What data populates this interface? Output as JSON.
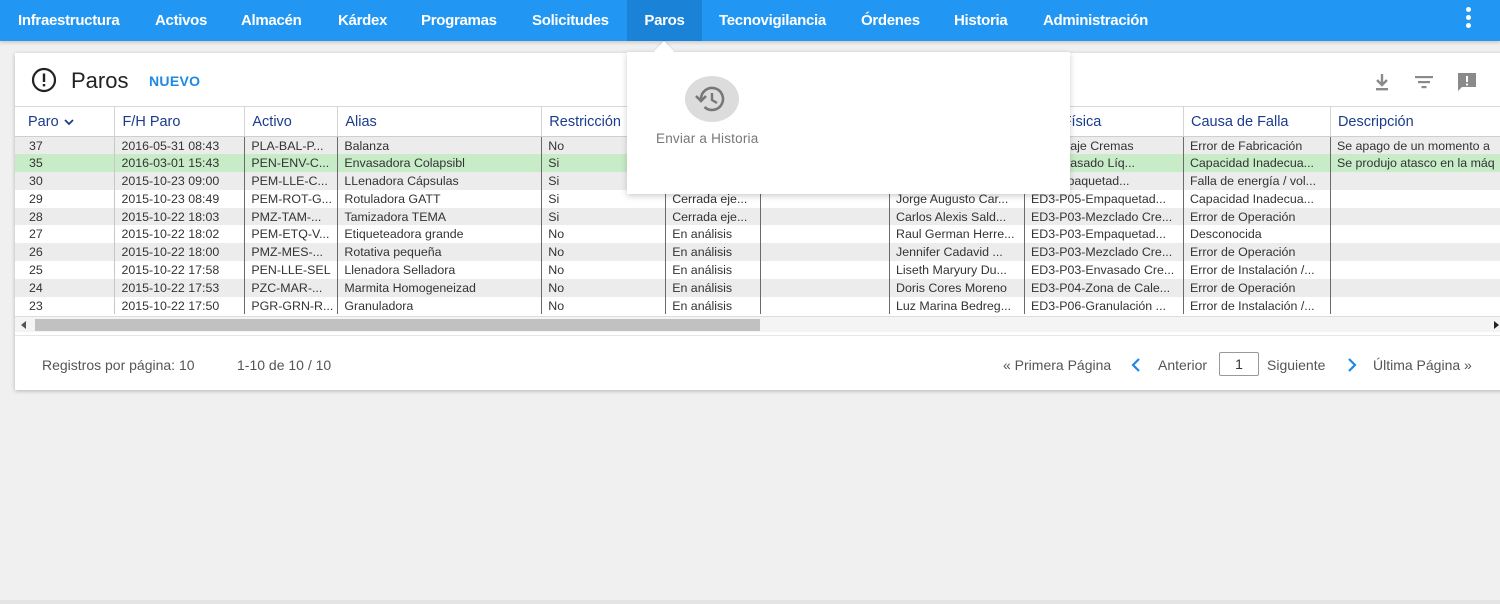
{
  "nav": {
    "items": [
      {
        "label": "Infraestructura"
      },
      {
        "label": "Activos"
      },
      {
        "label": "Almacén"
      },
      {
        "label": "Kárdex"
      },
      {
        "label": "Programas"
      },
      {
        "label": "Solicitudes"
      },
      {
        "label": "Paros"
      },
      {
        "label": "Tecnovigilancia"
      },
      {
        "label": "Órdenes"
      },
      {
        "label": "Historia"
      },
      {
        "label": "Administración"
      }
    ],
    "active": "Paros",
    "more_icon": "more-vert-icon"
  },
  "card": {
    "title": "Paros",
    "new_label": "NUEVO",
    "title_icon": "alert-circle-icon",
    "actions": [
      "download-icon",
      "filter-icon",
      "feedback-icon"
    ]
  },
  "table": {
    "columns": [
      "Paro",
      "F/H Paro",
      "Activo",
      "Alias",
      "Restricción",
      "",
      "",
      "",
      "ción Física",
      "Causa de Falla",
      "Descripción"
    ],
    "sort_column": "Paro",
    "rows": [
      [
        "37",
        "2016-05-31 08:43",
        "PLA-BAL-P...",
        "Balanza",
        "No",
        "",
        "",
        "",
        "03-Pesaje Cremas",
        "Error de Fabricación",
        "Se apago de un momento a"
      ],
      [
        "35",
        "2016-03-01 15:43",
        "PEN-ENV-C...",
        "Envasadora Colapsibl",
        "Si",
        "",
        "",
        "",
        "05-Envasado Líq...",
        "Capacidad Inadecua...",
        "Se produjo atasco en la máq"
      ],
      [
        "30",
        "2015-10-23 09:00",
        "PEM-LLE-C...",
        "LLenadora Cápsulas",
        "Si",
        "",
        "",
        "",
        "05-Empaquetad...",
        "Falla de energía / vol...",
        ""
      ],
      [
        "29",
        "2015-10-23 08:49",
        "PEM-ROT-G...",
        "Rotuladora GATT",
        "Si",
        "Cerrada eje...",
        "",
        "Jorge Augusto Car...",
        "ED3-P05-Empaquetad...",
        "Capacidad Inadecua...",
        ""
      ],
      [
        "28",
        "2015-10-22 18:03",
        "PMZ-TAM-...",
        "Tamizadora TEMA",
        "Si",
        "Cerrada eje...",
        "",
        "Carlos Alexis Sald...",
        "ED3-P03-Mezclado Cre...",
        "Error de Operación",
        ""
      ],
      [
        "27",
        "2015-10-22 18:02",
        "PEM-ETQ-V...",
        "Etiqueteadora grande",
        "No",
        "En análisis",
        "",
        "Raul German Herre...",
        "ED3-P03-Empaquetad...",
        "Desconocida",
        ""
      ],
      [
        "26",
        "2015-10-22 18:00",
        "PMZ-MES-...",
        "Rotativa pequeña",
        "No",
        "En análisis",
        "",
        "Jennifer Cadavid ...",
        "ED3-P03-Mezclado Cre...",
        "Error de Operación",
        ""
      ],
      [
        "25",
        "2015-10-22 17:58",
        "PEN-LLE-SEL",
        "Llenadora Selladora",
        "No",
        "En análisis",
        "",
        "Liseth Maryury Du...",
        "ED3-P03-Envasado Cre...",
        "Error de Instalación /...",
        ""
      ],
      [
        "24",
        "2015-10-22 17:53",
        "PZC-MAR-...",
        "Marmita Homogeneizad",
        "No",
        "En análisis",
        "",
        "Doris Cores Moreno",
        "ED3-P04-Zona de Cale...",
        "Error de Operación",
        ""
      ],
      [
        "23",
        "2015-10-22 17:50",
        "PGR-GRN-R...",
        "Granuladora",
        "No",
        "En análisis",
        "",
        "Luz Marina Bedreg...",
        "ED3-P06-Granulación ...",
        "Error de Instalación /...",
        ""
      ]
    ],
    "selected_row": "35"
  },
  "pager": {
    "per_page": "Registros por página: 10",
    "range": "1-10 de 10 / 10",
    "first": "« Primera Página",
    "prev": "Anterior",
    "page": "1",
    "next": "Siguiente",
    "last": "Última Página »"
  },
  "popup": {
    "action_label": "Enviar a Historia",
    "action_icon": "history-icon"
  },
  "colors": {
    "nav_bg": "#2196f3",
    "nav_active": "#1a83d8",
    "accent": "#1e88e5",
    "selected_row": "#c8ebc8"
  }
}
